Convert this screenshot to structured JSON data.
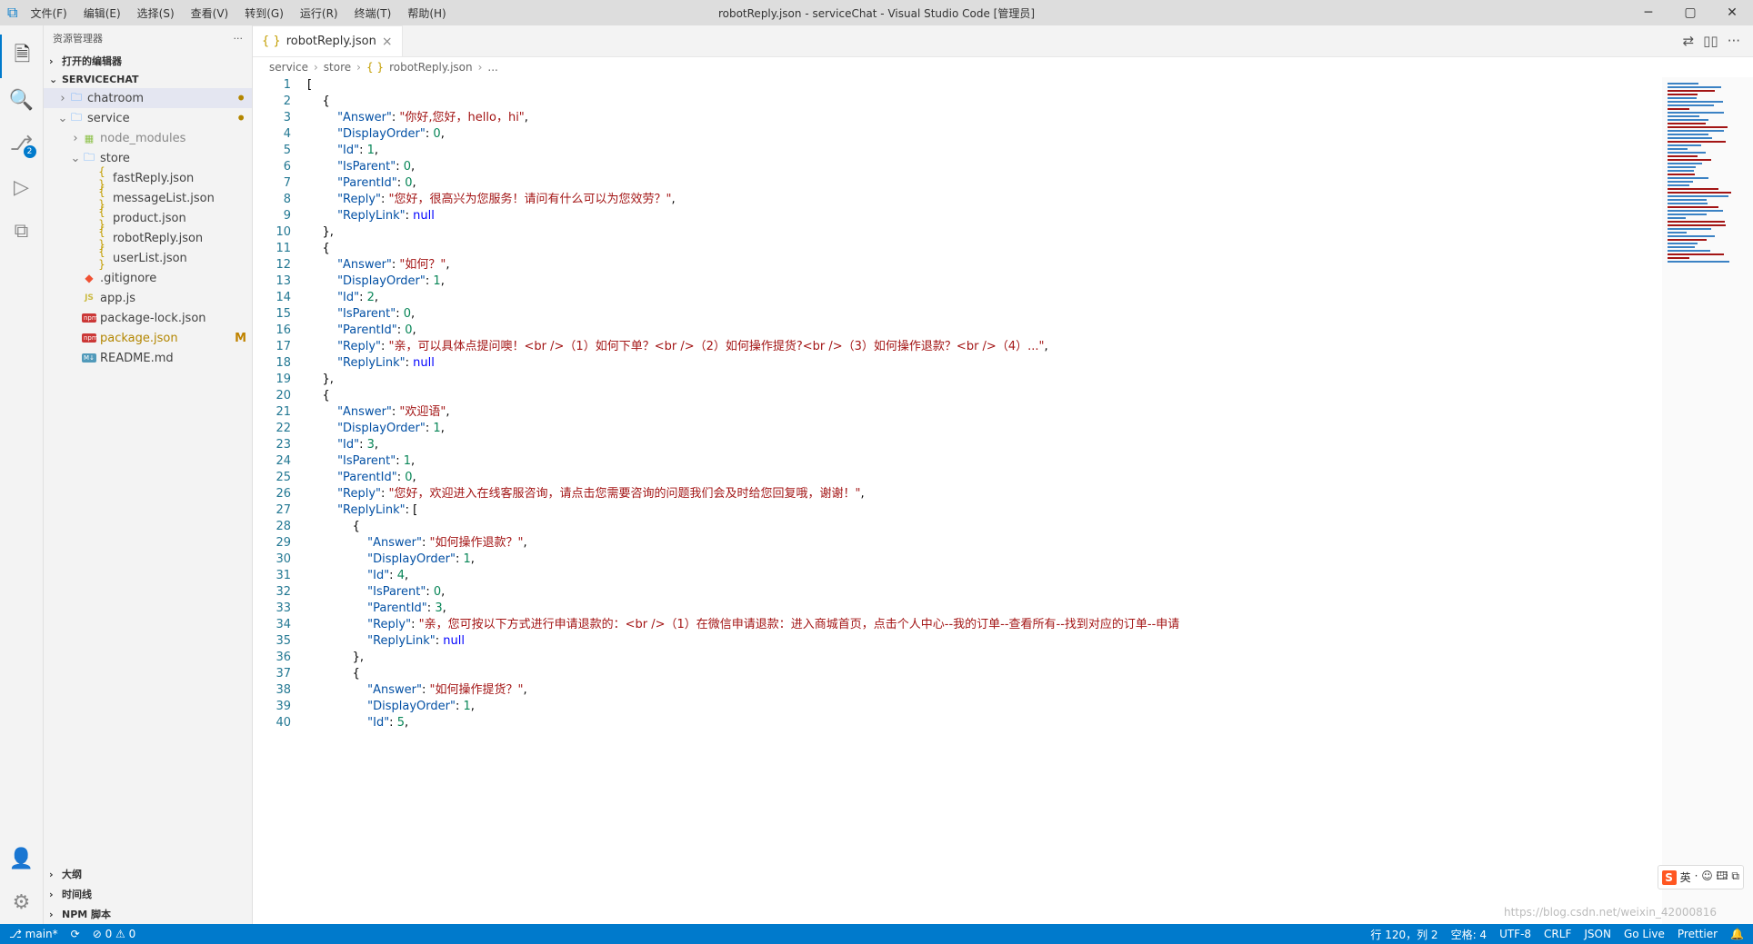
{
  "titlebar": {
    "title": "robotReply.json - serviceChat - Visual Studio Code [管理员]",
    "menus": [
      "文件(F)",
      "编辑(E)",
      "选择(S)",
      "查看(V)",
      "转到(G)",
      "运行(R)",
      "终端(T)",
      "帮助(H)"
    ]
  },
  "sidebar": {
    "header": "资源管理器",
    "ellipsis": "···",
    "open_editors": "打开的编辑器",
    "project": "SERVICECHAT",
    "tree": {
      "chatroom": "chatroom",
      "service": "service",
      "node_modules": "node_modules",
      "store": "store",
      "fastReply": "fastReply.json",
      "messageList": "messageList.json",
      "product": "product.json",
      "robotReply": "robotReply.json",
      "userList": "userList.json",
      "gitignore": ".gitignore",
      "appjs": "app.js",
      "pkglock": "package-lock.json",
      "pkg": "package.json",
      "pkg_flag": "M",
      "readme": "README.md"
    },
    "outline": "大纲",
    "timeline": "时间线",
    "npm": "NPM 脚本"
  },
  "activitybar": {
    "scm_badge": "2"
  },
  "tab": {
    "label": "robotReply.json"
  },
  "breadcrumbs": {
    "service": "service",
    "store": "store",
    "file": "robotReply.json",
    "tail": "..."
  },
  "code_lines": [
    {
      "n": 1,
      "h": "<span class='p'>[</span>"
    },
    {
      "n": 2,
      "h": "    <span class='p'>{</span>"
    },
    {
      "n": 3,
      "h": "        <span class='k'>\"Answer\"</span><span class='p'>: </span><span class='s'>\"你好,您好，hello，hi\"</span><span class='p'>,</span>"
    },
    {
      "n": 4,
      "h": "        <span class='k'>\"DisplayOrder\"</span><span class='p'>: </span><span class='n'>0</span><span class='p'>,</span>"
    },
    {
      "n": 5,
      "h": "        <span class='k'>\"Id\"</span><span class='p'>: </span><span class='n'>1</span><span class='p'>,</span>"
    },
    {
      "n": 6,
      "h": "        <span class='k'>\"IsParent\"</span><span class='p'>: </span><span class='n'>0</span><span class='p'>,</span>"
    },
    {
      "n": 7,
      "h": "        <span class='k'>\"ParentId\"</span><span class='p'>: </span><span class='n'>0</span><span class='p'>,</span>"
    },
    {
      "n": 8,
      "h": "        <span class='k'>\"Reply\"</span><span class='p'>: </span><span class='s'>\"您好，很高兴为您服务！请问有什么可以为您效劳？\"</span><span class='p'>,</span>"
    },
    {
      "n": 9,
      "h": "        <span class='k'>\"ReplyLink\"</span><span class='p'>: </span><span class='c'>null</span>"
    },
    {
      "n": 10,
      "h": "    <span class='p'>},</span>"
    },
    {
      "n": 11,
      "h": "    <span class='p'>{</span>"
    },
    {
      "n": 12,
      "h": "        <span class='k'>\"Answer\"</span><span class='p'>: </span><span class='s'>\"如何？\"</span><span class='p'>,</span>"
    },
    {
      "n": 13,
      "h": "        <span class='k'>\"DisplayOrder\"</span><span class='p'>: </span><span class='n'>1</span><span class='p'>,</span>"
    },
    {
      "n": 14,
      "h": "        <span class='k'>\"Id\"</span><span class='p'>: </span><span class='n'>2</span><span class='p'>,</span>"
    },
    {
      "n": 15,
      "h": "        <span class='k'>\"IsParent\"</span><span class='p'>: </span><span class='n'>0</span><span class='p'>,</span>"
    },
    {
      "n": 16,
      "h": "        <span class='k'>\"ParentId\"</span><span class='p'>: </span><span class='n'>0</span><span class='p'>,</span>"
    },
    {
      "n": 17,
      "h": "        <span class='k'>\"Reply\"</span><span class='p'>: </span><span class='s'>\"亲，可以具体点提问噢！&lt;br /&gt;（1）如何下单？&lt;br /&gt;（2）如何操作提货?&lt;br /&gt;（3）如何操作退款？&lt;br /&gt;（4）...\"</span><span class='p'>,</span>"
    },
    {
      "n": 18,
      "h": "        <span class='k'>\"ReplyLink\"</span><span class='p'>: </span><span class='c'>null</span>"
    },
    {
      "n": 19,
      "h": "    <span class='p'>},</span>"
    },
    {
      "n": 20,
      "h": "    <span class='p'>{</span>"
    },
    {
      "n": 21,
      "h": "        <span class='k'>\"Answer\"</span><span class='p'>: </span><span class='s'>\"欢迎语\"</span><span class='p'>,</span>"
    },
    {
      "n": 22,
      "h": "        <span class='k'>\"DisplayOrder\"</span><span class='p'>: </span><span class='n'>1</span><span class='p'>,</span>"
    },
    {
      "n": 23,
      "h": "        <span class='k'>\"Id\"</span><span class='p'>: </span><span class='n'>3</span><span class='p'>,</span>"
    },
    {
      "n": 24,
      "h": "        <span class='k'>\"IsParent\"</span><span class='p'>: </span><span class='n'>1</span><span class='p'>,</span>"
    },
    {
      "n": 25,
      "h": "        <span class='k'>\"ParentId\"</span><span class='p'>: </span><span class='n'>0</span><span class='p'>,</span>"
    },
    {
      "n": 26,
      "h": "        <span class='k'>\"Reply\"</span><span class='p'>: </span><span class='s'>\"您好，欢迎进入在线客服咨询，请点击您需要咨询的问题我们会及时给您回复哦，谢谢！\"</span><span class='p'>,</span>"
    },
    {
      "n": 27,
      "h": "        <span class='k'>\"ReplyLink\"</span><span class='p'>: [</span>"
    },
    {
      "n": 28,
      "h": "            <span class='p'>{</span>"
    },
    {
      "n": 29,
      "h": "                <span class='k'>\"Answer\"</span><span class='p'>: </span><span class='s'>\"如何操作退款？\"</span><span class='p'>,</span>"
    },
    {
      "n": 30,
      "h": "                <span class='k'>\"DisplayOrder\"</span><span class='p'>: </span><span class='n'>1</span><span class='p'>,</span>"
    },
    {
      "n": 31,
      "h": "                <span class='k'>\"Id\"</span><span class='p'>: </span><span class='n'>4</span><span class='p'>,</span>"
    },
    {
      "n": 32,
      "h": "                <span class='k'>\"IsParent\"</span><span class='p'>: </span><span class='n'>0</span><span class='p'>,</span>"
    },
    {
      "n": 33,
      "h": "                <span class='k'>\"ParentId\"</span><span class='p'>: </span><span class='n'>3</span><span class='p'>,</span>"
    },
    {
      "n": 34,
      "h": "                <span class='k'>\"Reply\"</span><span class='p'>: </span><span class='s'>\"亲，您可按以下方式进行申请退款的：&lt;br /&gt;（1）在微信申请退款：进入商城首页，点击个人中心--我的订单--查看所有--找到对应的订单--申请</span>"
    },
    {
      "n": 35,
      "h": "                <span class='k'>\"ReplyLink\"</span><span class='p'>: </span><span class='c'>null</span>"
    },
    {
      "n": 36,
      "h": "            <span class='p'>},</span>"
    },
    {
      "n": 37,
      "h": "            <span class='p'>{</span>"
    },
    {
      "n": 38,
      "h": "                <span class='k'>\"Answer\"</span><span class='p'>: </span><span class='s'>\"如何操作提货？\"</span><span class='p'>,</span>"
    },
    {
      "n": 39,
      "h": "                <span class='k'>\"DisplayOrder\"</span><span class='p'>: </span><span class='n'>1</span><span class='p'>,</span>"
    },
    {
      "n": 40,
      "h": "                <span class='k'>\"Id\"</span><span class='p'>: </span><span class='n'>5</span><span class='p'>,</span>"
    }
  ],
  "statusbar": {
    "branch": "main*",
    "sync": "⟳",
    "errors": "⊘ 0 ⚠ 0",
    "lncol": "行 120，列 2",
    "spaces": "空格: 4",
    "encoding": "UTF-8",
    "eol": "CRLF",
    "lang": "JSON",
    "golive": "Go Live",
    "prettier": "Prettier",
    "notif": "🔔"
  },
  "watermark": "https://blog.csdn.net/weixin_42000816",
  "ime": {
    "letter": "S",
    "lang": "英",
    "extras": "· ☺ 🖽 ⧉"
  }
}
